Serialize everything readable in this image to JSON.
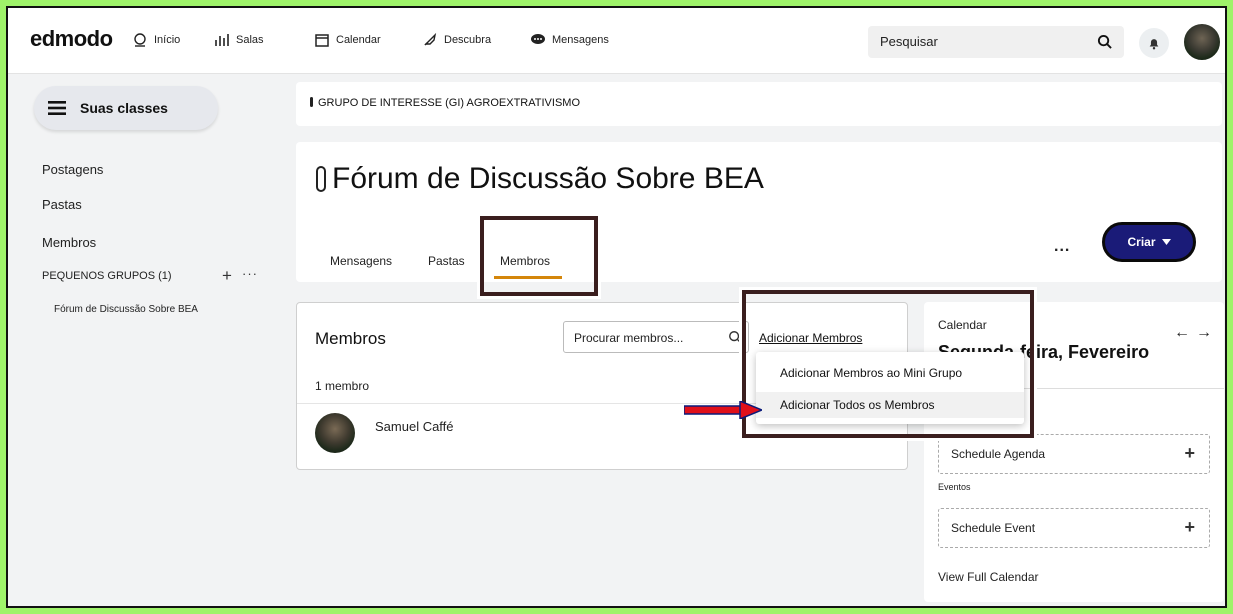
{
  "app": {
    "logo": "edmodo"
  },
  "nav": {
    "items": [
      {
        "label": "Início",
        "icon": "home-icon"
      },
      {
        "label": "Salas",
        "icon": "rooms-icon"
      },
      {
        "label": "Calendar",
        "icon": "calendar-icon"
      },
      {
        "label": "Descubra",
        "icon": "rocket-icon"
      },
      {
        "label": "Mensagens",
        "icon": "chat-icon"
      }
    ],
    "search_placeholder": "Pesquisar"
  },
  "sidebar": {
    "classes_button": "Suas classes",
    "links": [
      "Postagens",
      "Pastas",
      "Membros"
    ],
    "small_groups_label": "PEQUENOS GRUPOS (1)",
    "small_group_item": "Fórum de Discussão Sobre BEA"
  },
  "group": {
    "name": "GRUPO DE INTERESSE (GI) AGROEXTRATIVISMO"
  },
  "forum": {
    "title": "Fórum de Discussão Sobre BEA",
    "tabs": [
      "Mensagens",
      "Pastas",
      "Membros"
    ],
    "active_tab": "Membros",
    "more": "...",
    "create_button": "Criar"
  },
  "members": {
    "title": "Membros",
    "search_placeholder": "Procurar membros...",
    "add_link": "Adicionar Membros",
    "count": "1 membro",
    "list": [
      {
        "name": "Samuel Caffé"
      }
    ]
  },
  "dropdown": {
    "items": [
      "Adicionar Membros ao Mini Grupo",
      "Adicionar Todos os Membros"
    ],
    "highlighted": "Adicionar Todos os Membros"
  },
  "calendar": {
    "label": "Calendar",
    "date": "Segunda-feira, Fevereiro",
    "agenda_button": "Schedule Agenda",
    "events_label": "Eventos",
    "event_button": "Schedule Event",
    "view_full": "View Full Calendar"
  },
  "colors": {
    "background": "#9ff36a",
    "create_button": "#1a1b78",
    "tab_underline": "#d4860b",
    "annotation_arrow": "#e0101a",
    "annotation_box": "#3a1e1e"
  }
}
